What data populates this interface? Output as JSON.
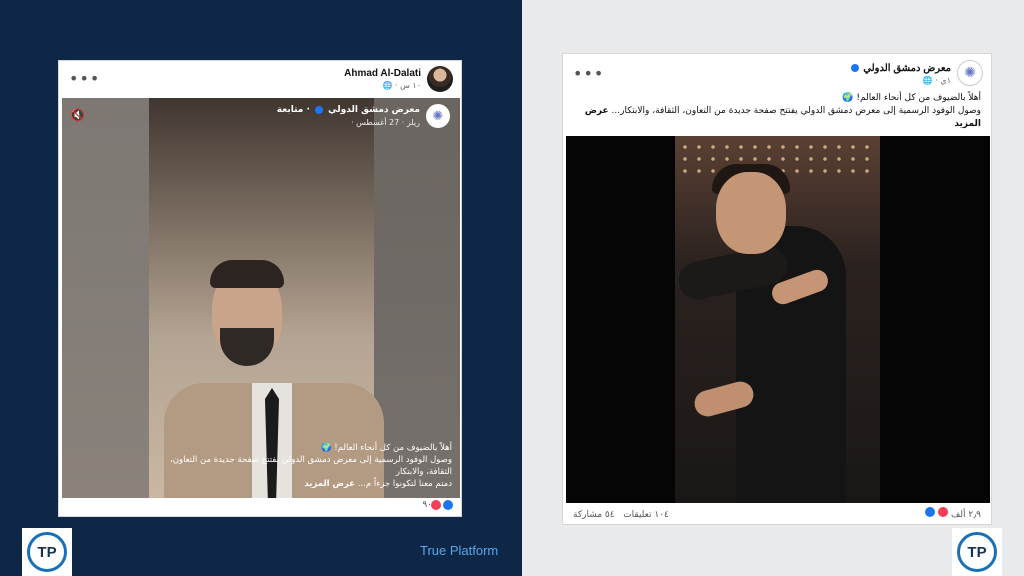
{
  "left_post": {
    "author": "Ahmad Al-Dalati",
    "time": "١٠ س ·",
    "reel": {
      "page_name": "معرض دمشق الدولي",
      "follow": "· متابعة",
      "meta": "ريلز · 27 أغسطس ·",
      "caption_line1": "أهلاً بالضيوف من كل أنحاء العالم! 🌍",
      "caption_line2": "وصول الوفود الرسمية إلى معرض دمشق الدولي يفتتح صفحة جديدة من التعاون، الثقافة، والابتكار",
      "caption_line3": "دمتم معنا لتكونوا جزءاً م...",
      "see_more": "عرض المزيد"
    },
    "reaction_count": "٩٠"
  },
  "right_post": {
    "page_name": "معرض دمشق الدولي",
    "time": "١ي ·",
    "text_line1": "أهلاً بالضيوف من كل أنحاء العالم! 🌍",
    "text_line2": "وصول الوفود الرسمية إلى معرض دمشق الدولي يفتتح صفحة جديدة من التعاون، الثقافة، والابتكار...",
    "see_more": "عرض المزيد",
    "reaction_count": "٢٫٩ ألف",
    "comments": "١٠٤ تعليقات",
    "shares": "٥٤ مشاركة"
  },
  "branding": {
    "name": "True Platform",
    "badge_text": "TP"
  },
  "colors": {
    "left_background": "#0f2747",
    "right_background": "#e9eaeb",
    "facebook_blue": "#1877f2",
    "brand_text": "#5aa6e8"
  },
  "icons": {
    "more": "more-horizontal-icon",
    "mute": "speaker-mute-icon",
    "globe": "globe-icon",
    "verified": "verified-badge-icon",
    "like": "like-reaction-icon",
    "love": "love-reaction-icon"
  }
}
